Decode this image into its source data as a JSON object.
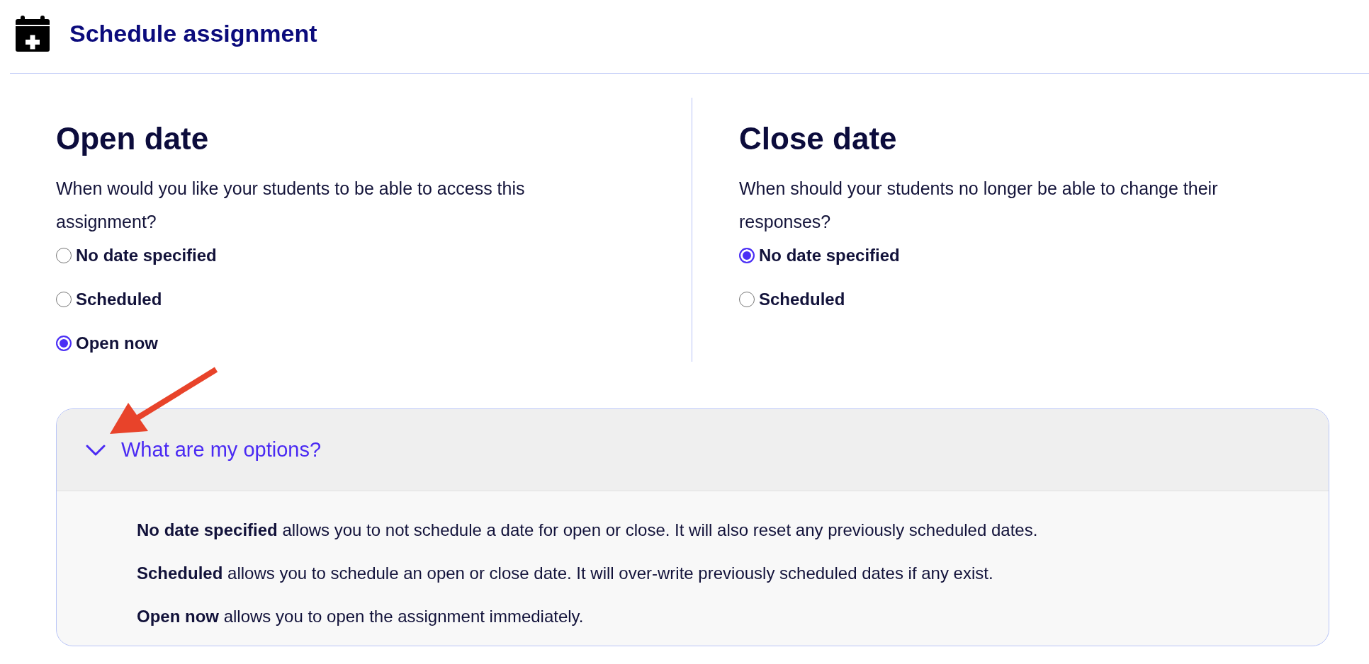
{
  "header": {
    "title": "Schedule assignment"
  },
  "sections": [
    {
      "heading": "Open date",
      "question": "When would you like your students to be able to access this assignment?",
      "options": [
        {
          "label": "No date specified",
          "selected": false
        },
        {
          "label": "Scheduled",
          "selected": false
        },
        {
          "label": "Open now",
          "selected": true
        }
      ]
    },
    {
      "heading": "Close date",
      "question": "When should your students no longer be able to change their responses?",
      "options": [
        {
          "label": "No date specified",
          "selected": true
        },
        {
          "label": "Scheduled",
          "selected": false
        }
      ]
    }
  ],
  "help": {
    "title": "What are my options?",
    "expanded": true,
    "paragraphs": [
      "**No date specified** allows you to not schedule a date for open or close. It will also reset any previously scheduled dates.",
      "**Scheduled** allows you to schedule an open or close date. It will over-write previously scheduled dates if any exist.",
      "**Open now** allows you to open the assignment immediately."
    ]
  },
  "annotations": [
    {
      "kind": "arrow"
    }
  ]
}
